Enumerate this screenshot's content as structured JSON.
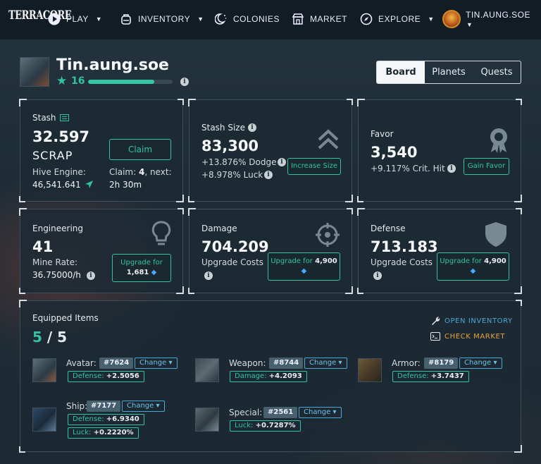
{
  "nav": {
    "logo": "TERRACORE",
    "play": "PLAY",
    "inventory": "INVENTORY",
    "colonies": "COLONIES",
    "market": "MARKET",
    "explore": "EXPLORE",
    "user": "TIN.AUNG.SOE"
  },
  "profile": {
    "name": "Tin.aung.soe",
    "level": "16",
    "xp_fraction": 0.78
  },
  "tabs": [
    "Board",
    "Planets",
    "Quests"
  ],
  "stash": {
    "title": "Stash",
    "amount": "32.597",
    "unit": "SCRAP",
    "hive_label": "Hive Engine:",
    "hive_value": "46,541.641",
    "claim_button": "Claim",
    "claim_prefix": "Claim: ",
    "claim_count": "4",
    "claim_suffix": ", next:",
    "next_time": "2h 30m"
  },
  "stash_size": {
    "title": "Stash Size",
    "value": "83,300",
    "dodge": "+13.876% Dodge",
    "luck": "+8.978% Luck",
    "button": "Increase Size"
  },
  "favor": {
    "title": "Favor",
    "value": "3,540",
    "crit": "+9.117% Crit. Hit",
    "button": "Gain Favor"
  },
  "engineering": {
    "title": "Engineering",
    "value": "41",
    "rate_label": "Mine Rate:",
    "rate_value": "36.75000/h",
    "button_line1": "Upgrade for",
    "button_amount": "1,681"
  },
  "damage": {
    "title": "Damage",
    "value": "704.209",
    "costs": "Upgrade Costs",
    "button_prefix": "Upgrade for ",
    "button_amount": "4,900"
  },
  "defense": {
    "title": "Defense",
    "value": "713.183",
    "costs": "Upgrade Costs",
    "button_prefix": "Upgrade for ",
    "button_amount": "4,900"
  },
  "equipped": {
    "title": "Equipped Items",
    "count": "5",
    "sep": "/",
    "total": "5",
    "open_inventory": "OPEN INVENTORY",
    "check_market": "CHECK MARKET",
    "change": "Change",
    "avatar": {
      "label": "Avatar:",
      "id": "#7624",
      "stat_label": "Defense:",
      "stat_value": "+2.5056"
    },
    "weapon": {
      "label": "Weapon:",
      "id": "#8744",
      "stat_label": "Damage:",
      "stat_value": "+4.2093"
    },
    "armor": {
      "label": "Armor:",
      "id": "#8179",
      "stat_label": "Defense:",
      "stat_value": "+3.7437"
    },
    "ship": {
      "label": "Ship:",
      "id": "#7177",
      "stat1_label": "Defense:",
      "stat1_value": "+6.9340",
      "stat2_label": "Luck:",
      "stat2_value": "+0.2220%"
    },
    "special": {
      "label": "Special:",
      "id": "#2561",
      "stat_label": "Luck:",
      "stat_value": "+0.7287%"
    }
  },
  "colors": {
    "accent": "#33c3a2",
    "link_blue": "#4aa8d8",
    "link_orange": "#e7a23a"
  }
}
